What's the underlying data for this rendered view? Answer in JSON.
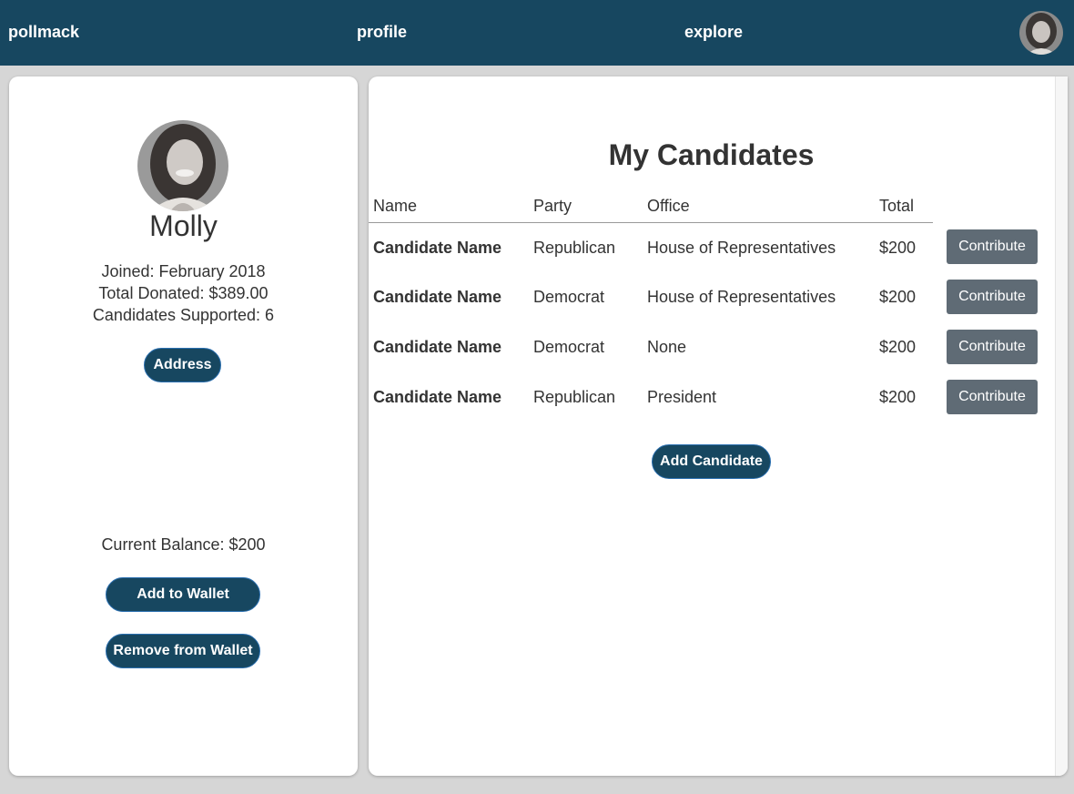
{
  "nav": {
    "brand": "pollmack",
    "profile": "profile",
    "explore": "explore"
  },
  "profile": {
    "name": "Molly",
    "joined": "Joined: February 2018",
    "total_donated": "Total Donated: $389.00",
    "candidates_supported": "Candidates Supported: 6",
    "address_button": "Address",
    "current_balance": "Current Balance: $200",
    "add_wallet_button": "Add to Wallet",
    "remove_wallet_button": "Remove from Wallet"
  },
  "candidates": {
    "title": "My Candidates",
    "headers": [
      "Name",
      "Party",
      "Office",
      "Total"
    ],
    "rows": [
      {
        "name": "Candidate Name",
        "party": "Republican",
        "office": "House of Representatives",
        "total": "$200",
        "action": "Contribute"
      },
      {
        "name": "Candidate Name",
        "party": "Democrat",
        "office": "House of Representatives",
        "total": "$200",
        "action": "Contribute"
      },
      {
        "name": "Candidate Name",
        "party": "Democrat",
        "office": "None",
        "total": "$200",
        "action": "Contribute"
      },
      {
        "name": "Candidate Name",
        "party": "Republican",
        "office": "President",
        "total": "$200",
        "action": "Contribute"
      }
    ],
    "add_button": "Add Candidate"
  },
  "colors": {
    "navbar": "#174760",
    "primary_button": "#174760",
    "contribute_button": "#5f6b75",
    "background": "#d6d6d6"
  }
}
